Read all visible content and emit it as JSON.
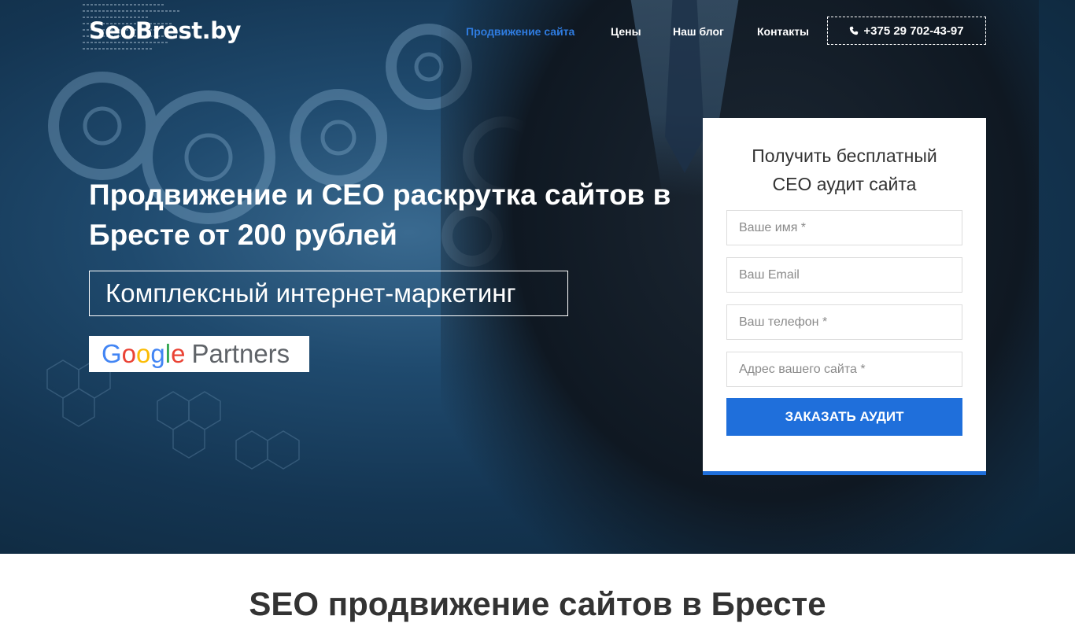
{
  "header": {
    "logo": "SeoBrest.by",
    "nav": [
      {
        "label": "Продвижение сайта",
        "active": true
      },
      {
        "label": "Цены",
        "active": false
      },
      {
        "label": "Наш блог",
        "active": false
      },
      {
        "label": "Контакты",
        "active": false
      }
    ],
    "phone": "+375 29 702-43-97",
    "phone_icon": "phone-icon"
  },
  "hero": {
    "headline_line1": "Продвижение и СЕО раскрутка сайтов в",
    "headline_line2_prefix": "Бресте от ",
    "headline_price": "200",
    "headline_line2_suffix": " рублей",
    "tagline": "Комплексный интернет-маркетинг",
    "badge_google": "Google",
    "badge_partners": "Partners"
  },
  "form": {
    "title_line1": "Получить бесплатный",
    "title_line2": "СЕО аудит сайта",
    "name_placeholder": "Ваше имя *",
    "email_placeholder": "Ваш Email",
    "phone_placeholder": "Ваш телефон *",
    "site_placeholder": "Адрес вашего сайта *",
    "submit_label": "ЗАКАЗАТЬ АУДИТ"
  },
  "section": {
    "title": "SEO продвижение сайтов в Бресте"
  },
  "colors": {
    "accent": "#1f6fdb",
    "nav_active": "#2f7ce0",
    "hero_bg": "#143552"
  }
}
